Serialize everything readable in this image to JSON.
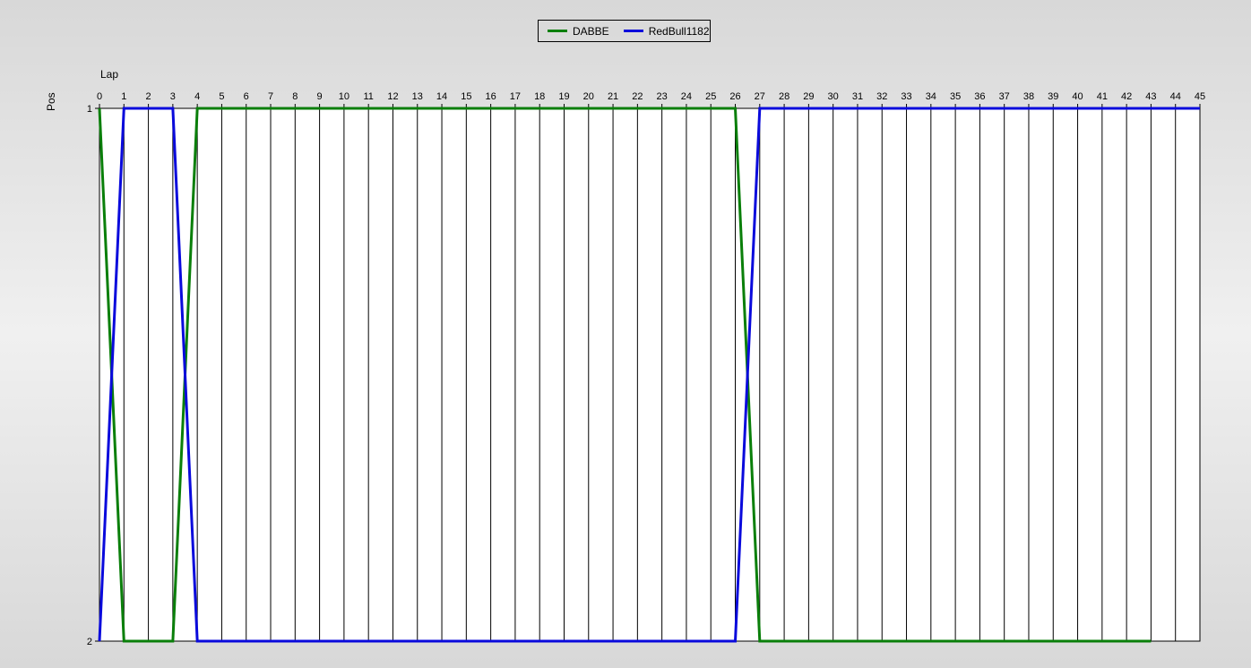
{
  "chart_data": {
    "type": "line",
    "xlabel": "Lap",
    "ylabel": "Pos",
    "xlim": [
      0,
      45
    ],
    "ylim": [
      1,
      2
    ],
    "y_inverted": true,
    "x_ticks": [
      0,
      1,
      2,
      3,
      4,
      5,
      6,
      7,
      8,
      9,
      10,
      11,
      12,
      13,
      14,
      15,
      16,
      17,
      18,
      19,
      20,
      21,
      22,
      23,
      24,
      25,
      26,
      27,
      28,
      29,
      30,
      31,
      32,
      33,
      34,
      35,
      36,
      37,
      38,
      39,
      40,
      41,
      42,
      43,
      44,
      45
    ],
    "y_ticks": [
      1,
      2
    ],
    "x_axis_position": "top",
    "grid": "vertical",
    "legend_position": "top-center",
    "series": [
      {
        "name": "DABBE",
        "color": "#0a7f0a",
        "x": [
          0,
          1,
          2,
          3,
          4,
          5,
          6,
          7,
          8,
          9,
          10,
          11,
          12,
          13,
          14,
          15,
          16,
          17,
          18,
          19,
          20,
          21,
          22,
          23,
          24,
          25,
          26,
          27,
          28,
          29,
          30,
          31,
          32,
          33,
          34,
          35,
          36,
          37,
          38,
          39,
          40,
          41,
          42,
          43
        ],
        "values": [
          1,
          2,
          2,
          2,
          1,
          1,
          1,
          1,
          1,
          1,
          1,
          1,
          1,
          1,
          1,
          1,
          1,
          1,
          1,
          1,
          1,
          1,
          1,
          1,
          1,
          1,
          1,
          2,
          2,
          2,
          2,
          2,
          2,
          2,
          2,
          2,
          2,
          2,
          2,
          2,
          2,
          2,
          2,
          2
        ]
      },
      {
        "name": "RedBull1182",
        "color": "#0a0adc",
        "x": [
          0,
          1,
          2,
          3,
          4,
          5,
          6,
          7,
          8,
          9,
          10,
          11,
          12,
          13,
          14,
          15,
          16,
          17,
          18,
          19,
          20,
          21,
          22,
          23,
          24,
          25,
          26,
          27,
          28,
          29,
          30,
          31,
          32,
          33,
          34,
          35,
          36,
          37,
          38,
          39,
          40,
          41,
          42,
          43,
          44,
          45
        ],
        "values": [
          2,
          1,
          1,
          1,
          2,
          2,
          2,
          2,
          2,
          2,
          2,
          2,
          2,
          2,
          2,
          2,
          2,
          2,
          2,
          2,
          2,
          2,
          2,
          2,
          2,
          2,
          2,
          1,
          1,
          1,
          1,
          1,
          1,
          1,
          1,
          1,
          1,
          1,
          1,
          1,
          1,
          1,
          1,
          1,
          1,
          1
        ]
      }
    ]
  }
}
